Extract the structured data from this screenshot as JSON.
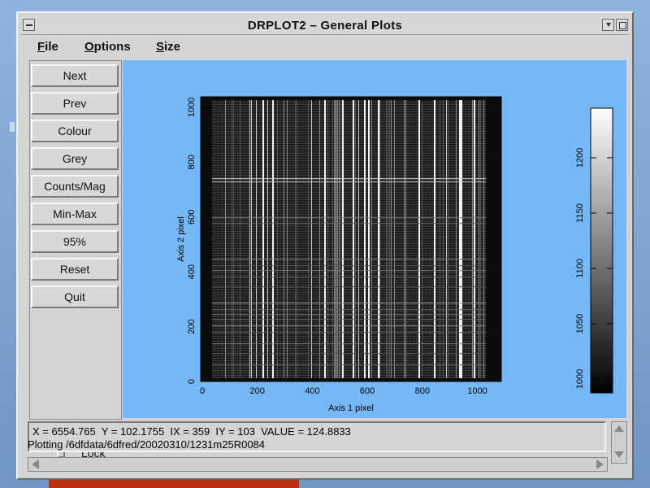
{
  "window": {
    "title": "DRPLOT2 – General Plots"
  },
  "menubar": {
    "items": [
      "File",
      "Options",
      "Size"
    ]
  },
  "panel": {
    "buttons": [
      "Next",
      "Prev",
      "Colour",
      "Grey",
      "Counts/Mag",
      "Min-Max",
      "95%",
      "Reset",
      "Quit"
    ],
    "lock_label": "Lock"
  },
  "plot": {
    "xlabel": "Axis 1 pixel",
    "ylabel": "Axis 2 pixel",
    "x_ticks": [
      "0",
      "200",
      "400",
      "600",
      "800",
      "1000"
    ],
    "y_ticks": [
      "0",
      "200",
      "400",
      "600",
      "800",
      "1000"
    ],
    "colorbar_ticks": [
      "1000",
      "1050",
      "1100",
      "1150",
      "1200"
    ]
  },
  "status": {
    "line1": "X = 6554.765  Y = 102.1755  IX = 359  IY = 103  VALUE = 124.8833",
    "line2": "Plotting /6dfdata/6dfred/20020310/1231m25R0084"
  },
  "colors": {
    "plot_background": "#75b8f6",
    "window": "#d4d4d4"
  }
}
